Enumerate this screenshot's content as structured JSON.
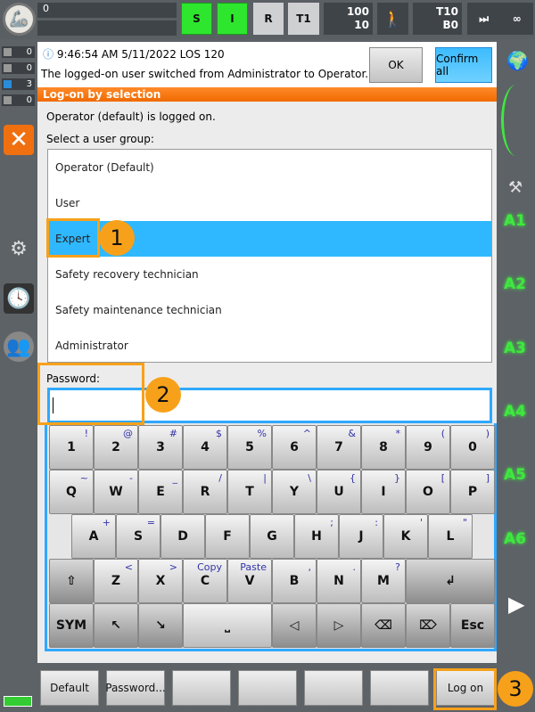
{
  "topbar": {
    "field1": "0",
    "field2": "",
    "s": "S",
    "i": "I",
    "r": "R",
    "t1": "T1",
    "override": "100",
    "jog": "10",
    "tool": "T10",
    "base": "B0",
    "incr": "∞"
  },
  "counters": [
    "0",
    "0",
    "3",
    "0"
  ],
  "message": {
    "text_time": "9:46:54 AM 5/11/2022 LOS 120",
    "text": "The logged-on user switched from Administrator to Operator.",
    "ok": "OK",
    "confirm_all": "Confirm all"
  },
  "header": "Log-on by selection",
  "status": "Operator (default) is logged on.",
  "select_label": "Select a user group:",
  "groups": [
    "Operator (Default)",
    "User",
    "Expert",
    "Safety recovery technician",
    "Safety maintenance technician",
    "Administrator"
  ],
  "selected_group": "Expert",
  "password_label": "Password:",
  "password_value": "",
  "keyboard": {
    "row1": [
      [
        "1",
        "!"
      ],
      [
        "2",
        "@"
      ],
      [
        "3",
        "#"
      ],
      [
        "4",
        "$"
      ],
      [
        "5",
        "%"
      ],
      [
        "6",
        "^"
      ],
      [
        "7",
        "&"
      ],
      [
        "8",
        "*"
      ],
      [
        "9",
        "("
      ],
      [
        "0",
        ")"
      ]
    ],
    "row2": [
      [
        "Q",
        "~"
      ],
      [
        "W",
        "-"
      ],
      [
        "E",
        "_"
      ],
      [
        "R",
        "/"
      ],
      [
        "T",
        "|"
      ],
      [
        "Y",
        "\\"
      ],
      [
        "U",
        "{"
      ],
      [
        "I",
        "}"
      ],
      [
        "O",
        "["
      ],
      [
        "P",
        "]"
      ]
    ],
    "row3": [
      [
        "A",
        "+"
      ],
      [
        "S",
        "="
      ],
      [
        "D",
        ""
      ],
      [
        "F",
        ""
      ],
      [
        "G",
        ""
      ],
      [
        "H",
        ";"
      ],
      [
        "J",
        ":"
      ],
      [
        "K",
        "'"
      ],
      [
        "L",
        "\""
      ]
    ],
    "row4": [
      [
        "Z",
        "<"
      ],
      [
        "X",
        ">"
      ],
      [
        "C",
        "Copy"
      ],
      [
        "V",
        "Paste"
      ],
      [
        "B",
        ","
      ],
      [
        "N",
        "."
      ],
      [
        "M",
        "?"
      ]
    ],
    "shift": "⇧",
    "enter": "↲",
    "sym": "SYM",
    "home": "↖",
    "end": "↘",
    "space": "⎵",
    "left": "◁",
    "right": "▷",
    "backspace": "⌫",
    "delete": "⌦",
    "esc": "Esc"
  },
  "axes": [
    "A1",
    "A2",
    "A3",
    "A4",
    "A5",
    "A6"
  ],
  "buttons": [
    "Default",
    "Password...",
    "",
    "",
    "",
    "",
    "Log on"
  ],
  "annotations": [
    "1",
    "2",
    "3"
  ],
  "colors": {
    "accent": "#2fb8ff",
    "orange": "#f7a11a",
    "green": "#2ee62e"
  }
}
